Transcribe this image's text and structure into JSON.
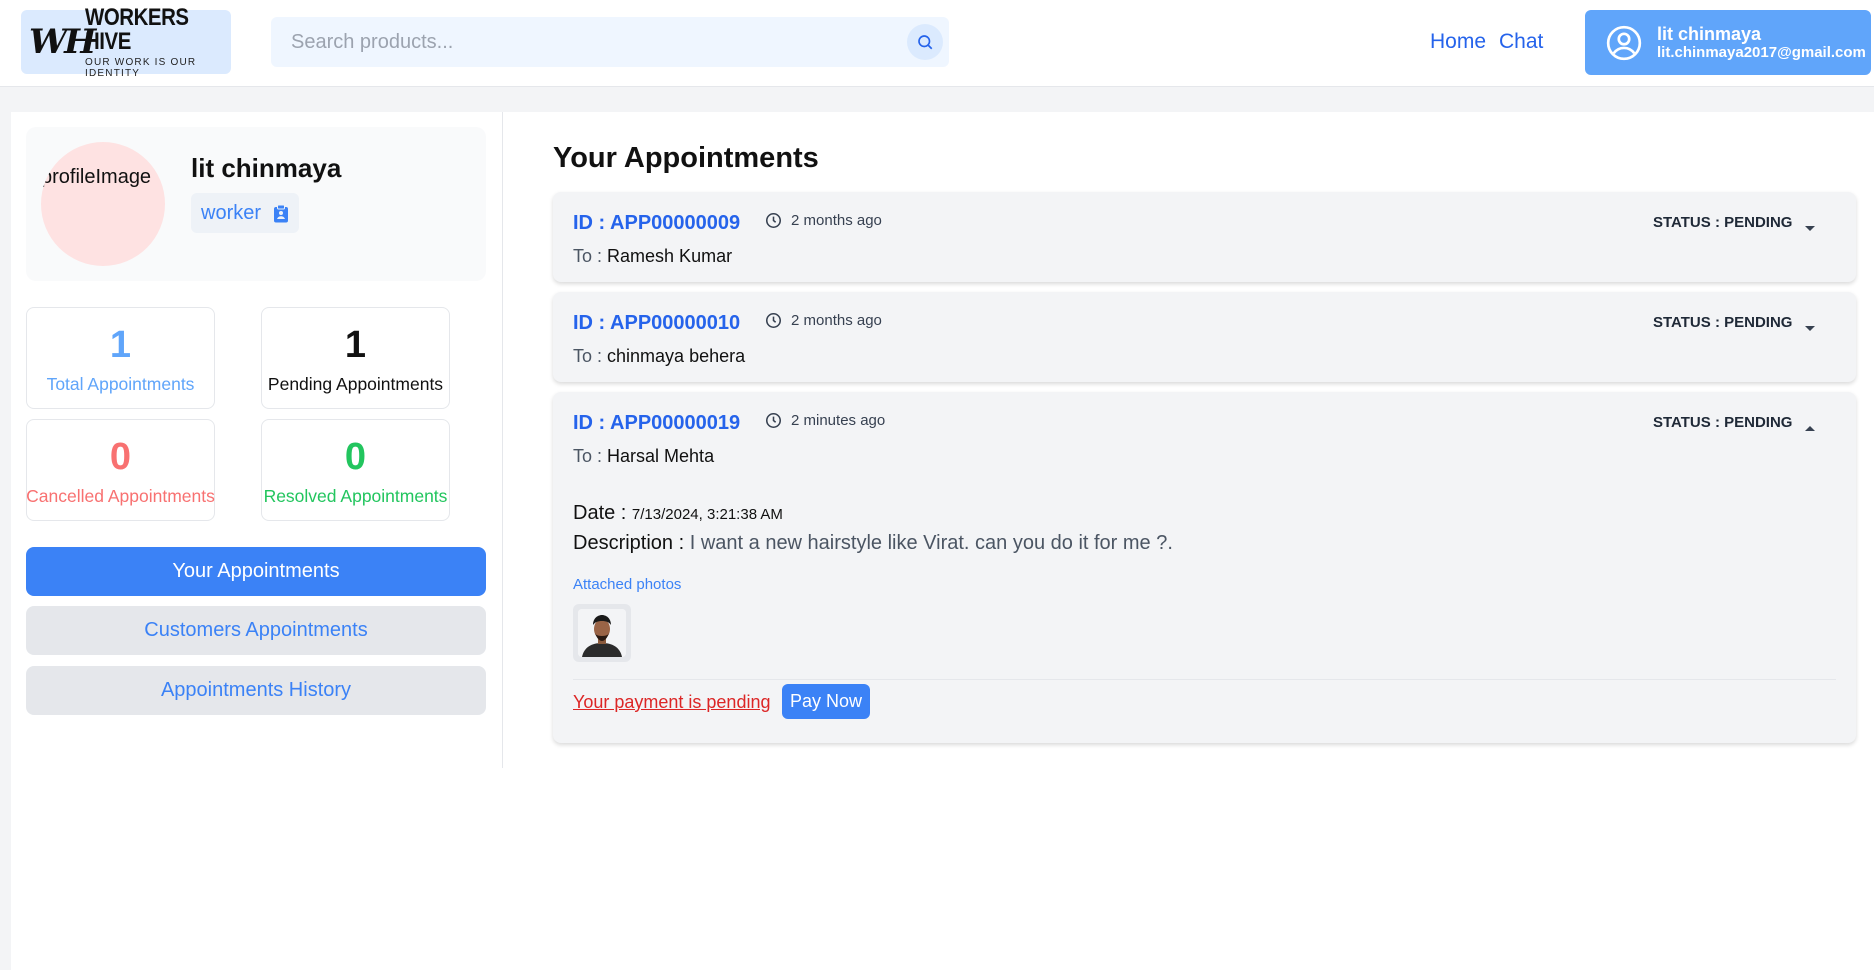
{
  "header": {
    "logo": {
      "mark": "WH",
      "title": "WORKERS HIVE",
      "tagline": "OUR WORK IS OUR IDENTITY"
    },
    "search": {
      "placeholder": "Search products...",
      "icon": "search-icon"
    },
    "nav": {
      "home": "Home",
      "chat": "Chat"
    },
    "user": {
      "name": "lit chinmaya",
      "email": "lit.chinmaya2017@gmail.com",
      "icon": "user-circle-icon"
    }
  },
  "profile": {
    "image_alt": "profileImage",
    "name": "lit chinmaya",
    "role": "worker",
    "role_icon": "clipboard-icon"
  },
  "stats": {
    "total": {
      "value": "1",
      "label": "Total Appointments"
    },
    "pending": {
      "value": "1",
      "label": "Pending Appointments"
    },
    "cancelled": {
      "value": "0",
      "label": "Cancelled Appointments"
    },
    "resolved": {
      "value": "0",
      "label": "Resolved Appointments"
    }
  },
  "sidebar": {
    "buttons": [
      {
        "label": "Your Appointments",
        "active": true
      },
      {
        "label": "Customers Appointments",
        "active": false
      },
      {
        "label": "Appointments History",
        "active": false
      }
    ]
  },
  "appointments": {
    "title": "Your Appointments",
    "items": [
      {
        "id": "ID : APP00000009",
        "time": "2 months ago",
        "to_label": "To :",
        "to": "Ramesh Kumar",
        "status": "STATUS : PENDING",
        "expanded": false
      },
      {
        "id": "ID : APP00000010",
        "time": "2 months ago",
        "to_label": "To :",
        "to": "chinmaya behera",
        "status": "STATUS : PENDING",
        "expanded": false
      },
      {
        "id": "ID : APP00000019",
        "time": "2 minutes ago",
        "to_label": "To :",
        "to": "Harsal Mehta",
        "status": "STATUS : PENDING",
        "expanded": true,
        "date_label": "Date :",
        "date": "7/13/2024, 3:21:38 AM",
        "description_label": "Description :",
        "description": "I want a new hairstyle like Virat. can you do it for me ?.",
        "attached_label": "Attached photos",
        "payment_text": "Your payment is pending",
        "pay_button": "Pay Now"
      }
    ]
  },
  "colors": {
    "accent": "#3b82f6",
    "link": "#2563eb",
    "danger": "#dc2626",
    "success": "#22c55e",
    "cancel": "#f87171"
  }
}
